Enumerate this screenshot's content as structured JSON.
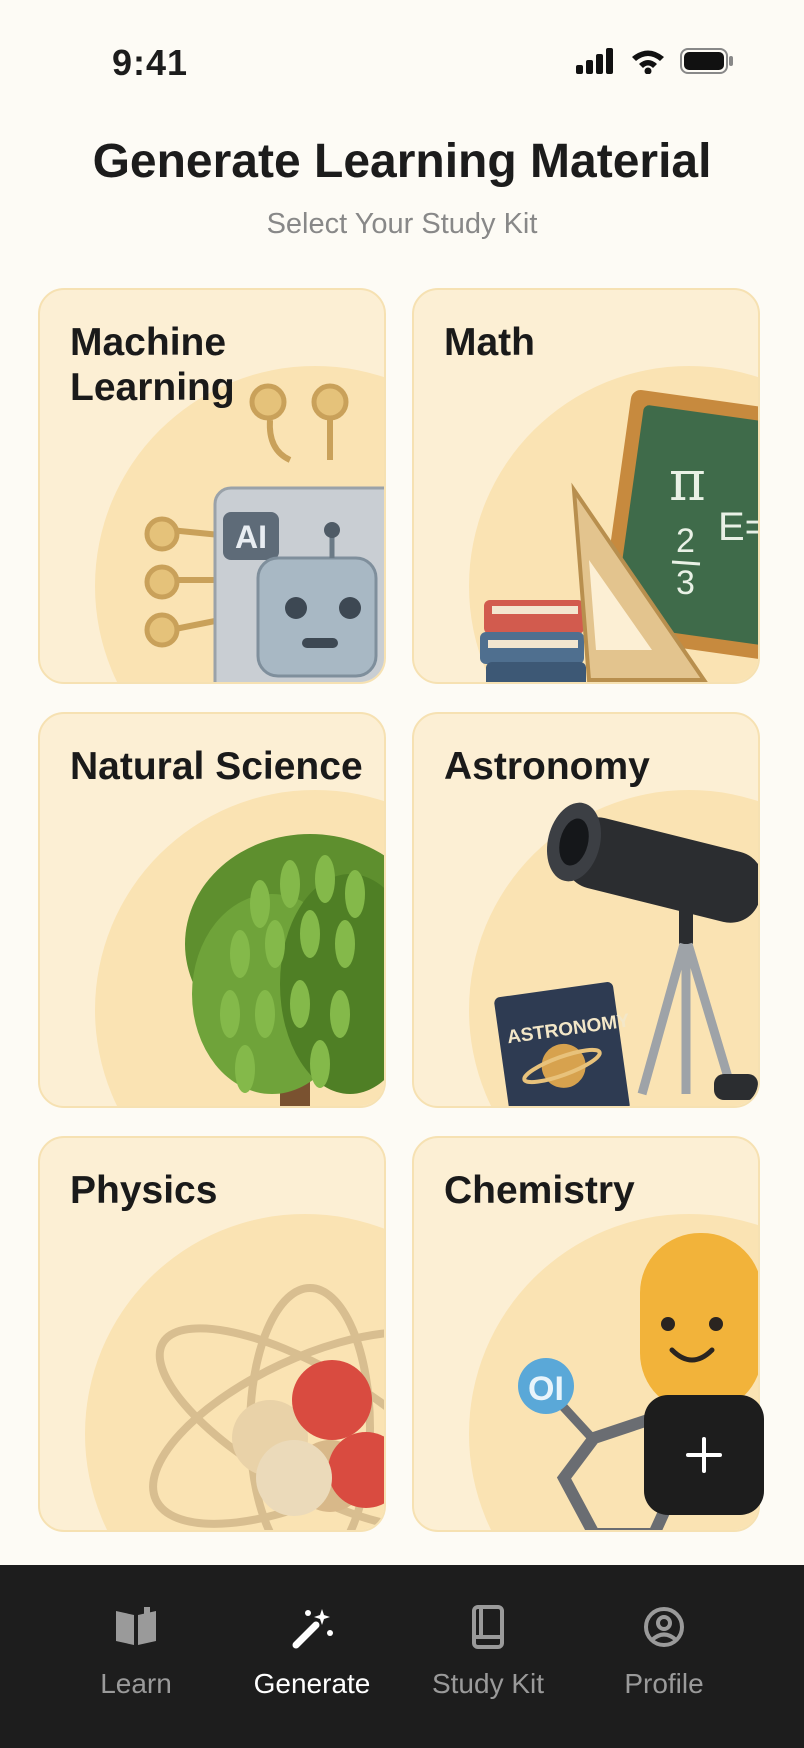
{
  "status_bar": {
    "time": "9:41"
  },
  "header": {
    "title": "Generate Learning Material",
    "subtitle": "Select Your Study Kit"
  },
  "kits": [
    {
      "label": "Machine Learning",
      "art": "robot-icon"
    },
    {
      "label": "Math",
      "art": "chalkboard-icon"
    },
    {
      "label": "Natural Science",
      "art": "tree-icon"
    },
    {
      "label": "Astronomy",
      "art": "telescope-icon"
    },
    {
      "label": "Physics",
      "art": "atom-icon"
    },
    {
      "label": "Chemistry",
      "art": "molecule-icon"
    }
  ],
  "art_text": {
    "ai_chip": "AI",
    "pi": "π",
    "fraction_num": "2",
    "fraction_den": "3",
    "e_eq": "E=",
    "astronomy_book": "ASTRONOMY",
    "element": "OI"
  },
  "fab": {
    "icon": "plus-icon"
  },
  "tabbar": {
    "tabs": [
      {
        "label": "Learn",
        "icon": "open-book-icon"
      },
      {
        "label": "Generate",
        "icon": "magic-wand-icon",
        "active": true
      },
      {
        "label": "Study Kit",
        "icon": "book-icon"
      },
      {
        "label": "Profile",
        "icon": "user-circle-icon"
      }
    ]
  },
  "colors": {
    "accent": "#1d1d1d",
    "card": "#FCEFD4",
    "card_border": "#F6E1B2",
    "background": "#FDFBF5"
  }
}
